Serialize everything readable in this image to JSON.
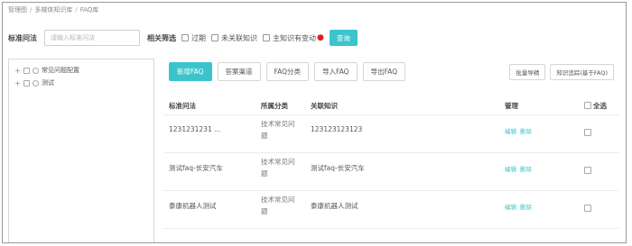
{
  "breadcrumb": [
    "管理图",
    "多媒体知识库",
    "FAQ库"
  ],
  "filter": {
    "label": "标准问法",
    "placeholder": "请输入标准问法",
    "related_label": "相关筛选",
    "options": [
      "过期",
      "未关联知识",
      "主知识有变动"
    ],
    "query_label": "查询"
  },
  "tree": [
    {
      "label": "常见问题配置"
    },
    {
      "label": "测试"
    }
  ],
  "toolbar": {
    "buttons": [
      "新增FAQ",
      "答案渠道",
      "FAQ分类",
      "导入FAQ",
      "导出FAQ"
    ],
    "right_buttons": [
      "批量导精",
      "知识追踪(基于FAQ)"
    ]
  },
  "table": {
    "headers": [
      "标准问法",
      "所属分类",
      "关联知识",
      "管理",
      "全选"
    ],
    "action_labels": [
      "编辑",
      "删除"
    ],
    "rows": [
      {
        "question": "1231231231 ...",
        "category_lines": [
          "技术常见问",
          "题"
        ],
        "related": "123123123123"
      },
      {
        "question": "测试faq-长安汽车",
        "category_lines": [
          "技术常见问",
          "题"
        ],
        "related": "测试faq-长安汽车"
      },
      {
        "question": "泰康机器人测试",
        "category_lines": [
          "技术常见问",
          "题"
        ],
        "related": "泰康机器人测试"
      }
    ]
  },
  "colors": {
    "accent": "#3cc4cc",
    "warning_dot": "#e02020"
  }
}
